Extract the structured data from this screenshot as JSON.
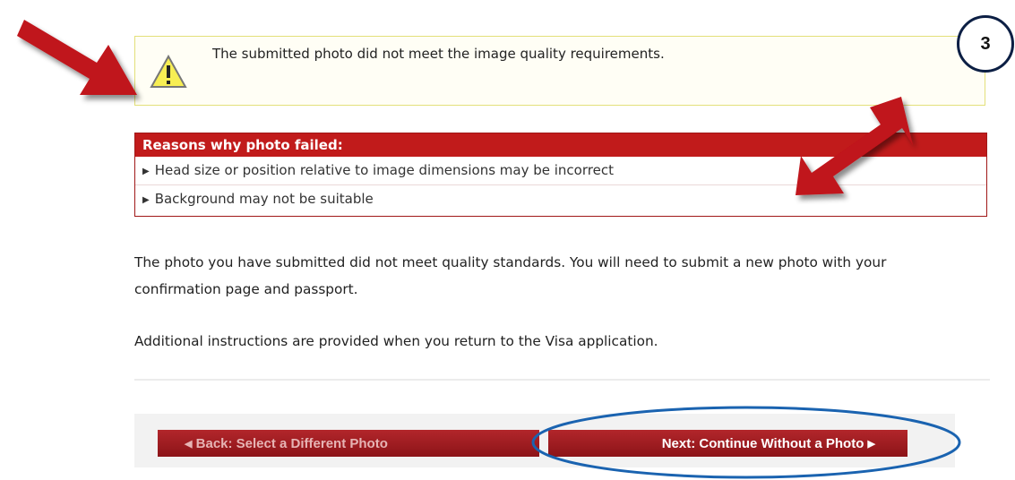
{
  "warning": {
    "message": "The submitted photo did not meet the image quality requirements."
  },
  "step_badge": "3",
  "reasons": {
    "heading": "Reasons why photo failed:",
    "items": [
      "Head size or position relative to image dimensions may be incorrect",
      "Background may not be suitable"
    ]
  },
  "paragraphs": {
    "p1": "The photo you have submitted did not meet quality standards. You will need to submit a new photo with your confirmation page and passport.",
    "p2": "Additional instructions are provided when you return to the Visa application."
  },
  "buttons": {
    "back_label": "Back: Select a Different Photo",
    "next_label": "Next: Continue Without a Photo"
  },
  "colors": {
    "accent_red": "#c11b1b",
    "annotation_arrow": "#c0121a",
    "annotation_ellipse": "#1a63b0",
    "warning_border": "#e3e07a"
  },
  "icons": {
    "warning": "warning-triangle-icon",
    "bullet": "triangle-right-icon",
    "back": "triangle-left-icon",
    "next": "triangle-right-icon"
  }
}
